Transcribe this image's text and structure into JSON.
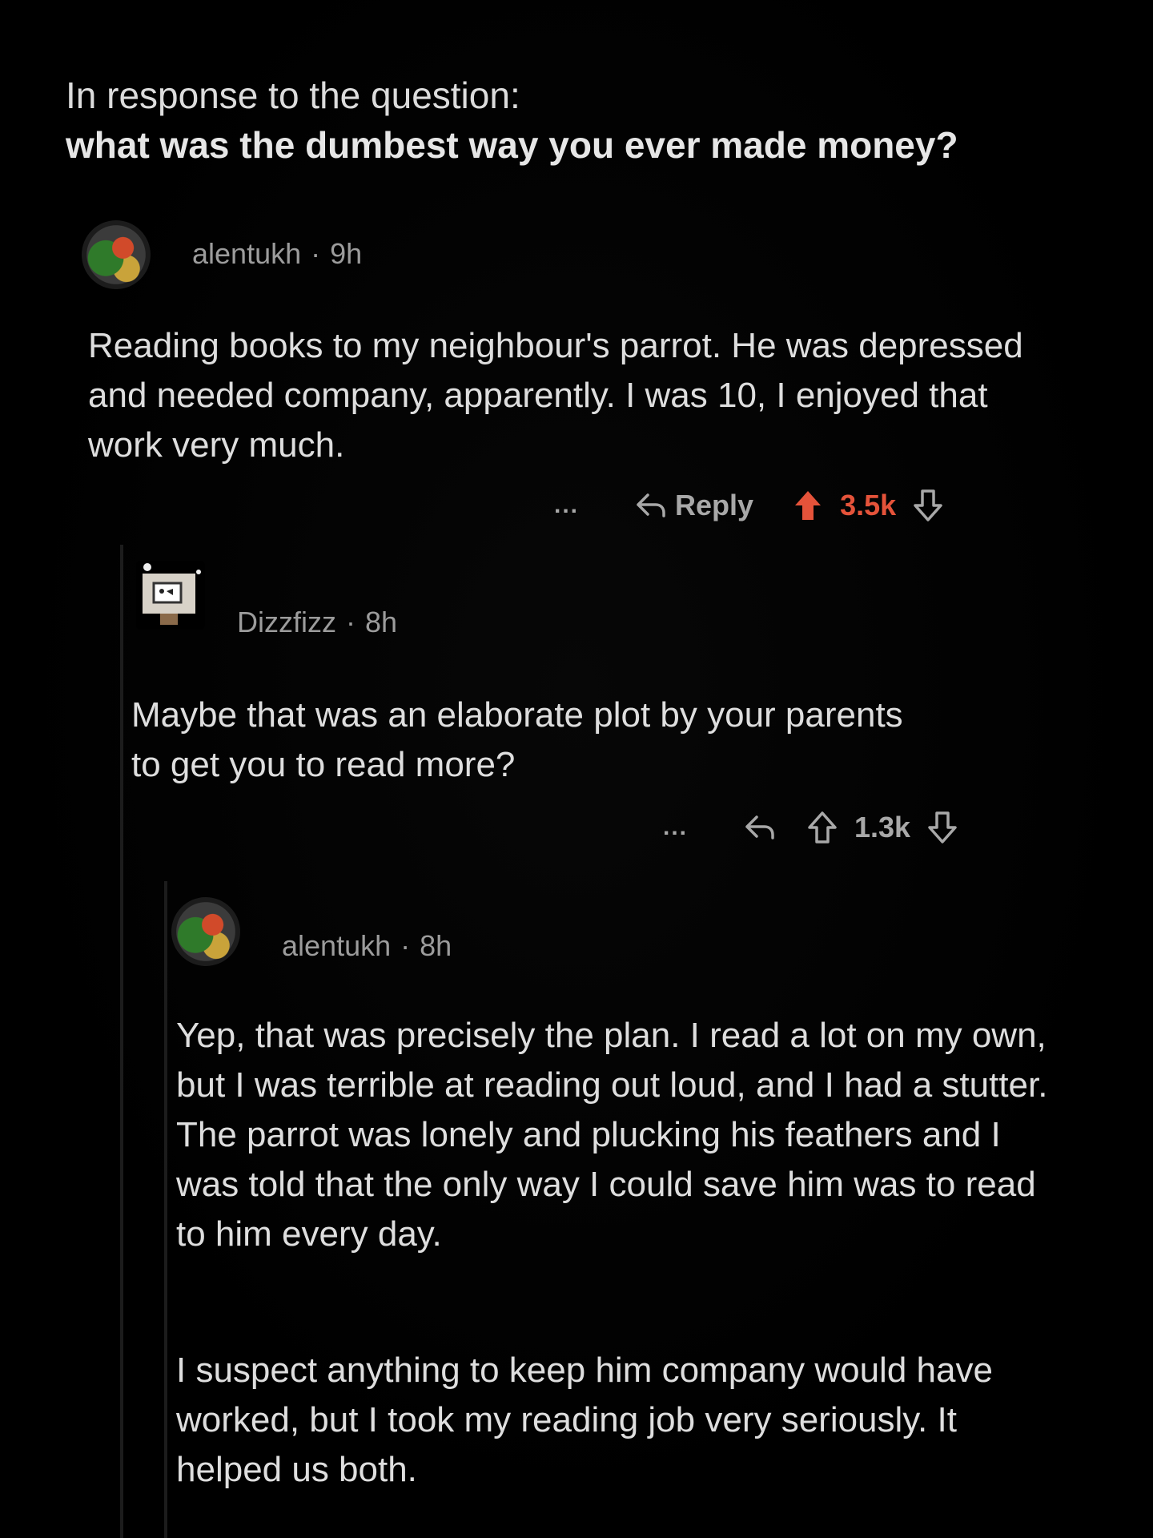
{
  "prompt": {
    "line1": "In response to the question:",
    "line2": "what was the dumbest way you ever made money?"
  },
  "comments": [
    {
      "user": "alentukh",
      "time": "9h",
      "avatar_icon": "parrot-avatar-icon",
      "text": "Reading books to my neighbour's parrot. He was depressed and needed company, apparently. I was 10, I enjoyed that work very much.",
      "more": "...",
      "reply_label": "Reply",
      "votes": "3.5k",
      "upvoted": true
    },
    {
      "user": "Dizzfizz",
      "time": "8h",
      "avatar_icon": "robot-avatar-icon",
      "text": "Maybe that was an elaborate plot by your parents to get you to read more?",
      "more": "...",
      "votes": "1.3k",
      "upvoted": false
    },
    {
      "user": "alentukh",
      "time": "8h",
      "avatar_icon": "parrot-avatar-icon",
      "paragraph1": "Yep, that was precisely the plan. I read a lot on my own, but I was terrible at reading out loud, and I had a stutter. The parrot was lonely and plucking his feathers and I was told that the only way I could save him was to read to him every day.",
      "paragraph2": "I suspect anything to keep him company would have worked, but I took my reading job very seriously. It helped us both."
    }
  ],
  "colors": {
    "background": "#000000",
    "upvote_active": "#e5533a",
    "meta_text": "#9c9c9c",
    "body_text": "#dedede"
  }
}
